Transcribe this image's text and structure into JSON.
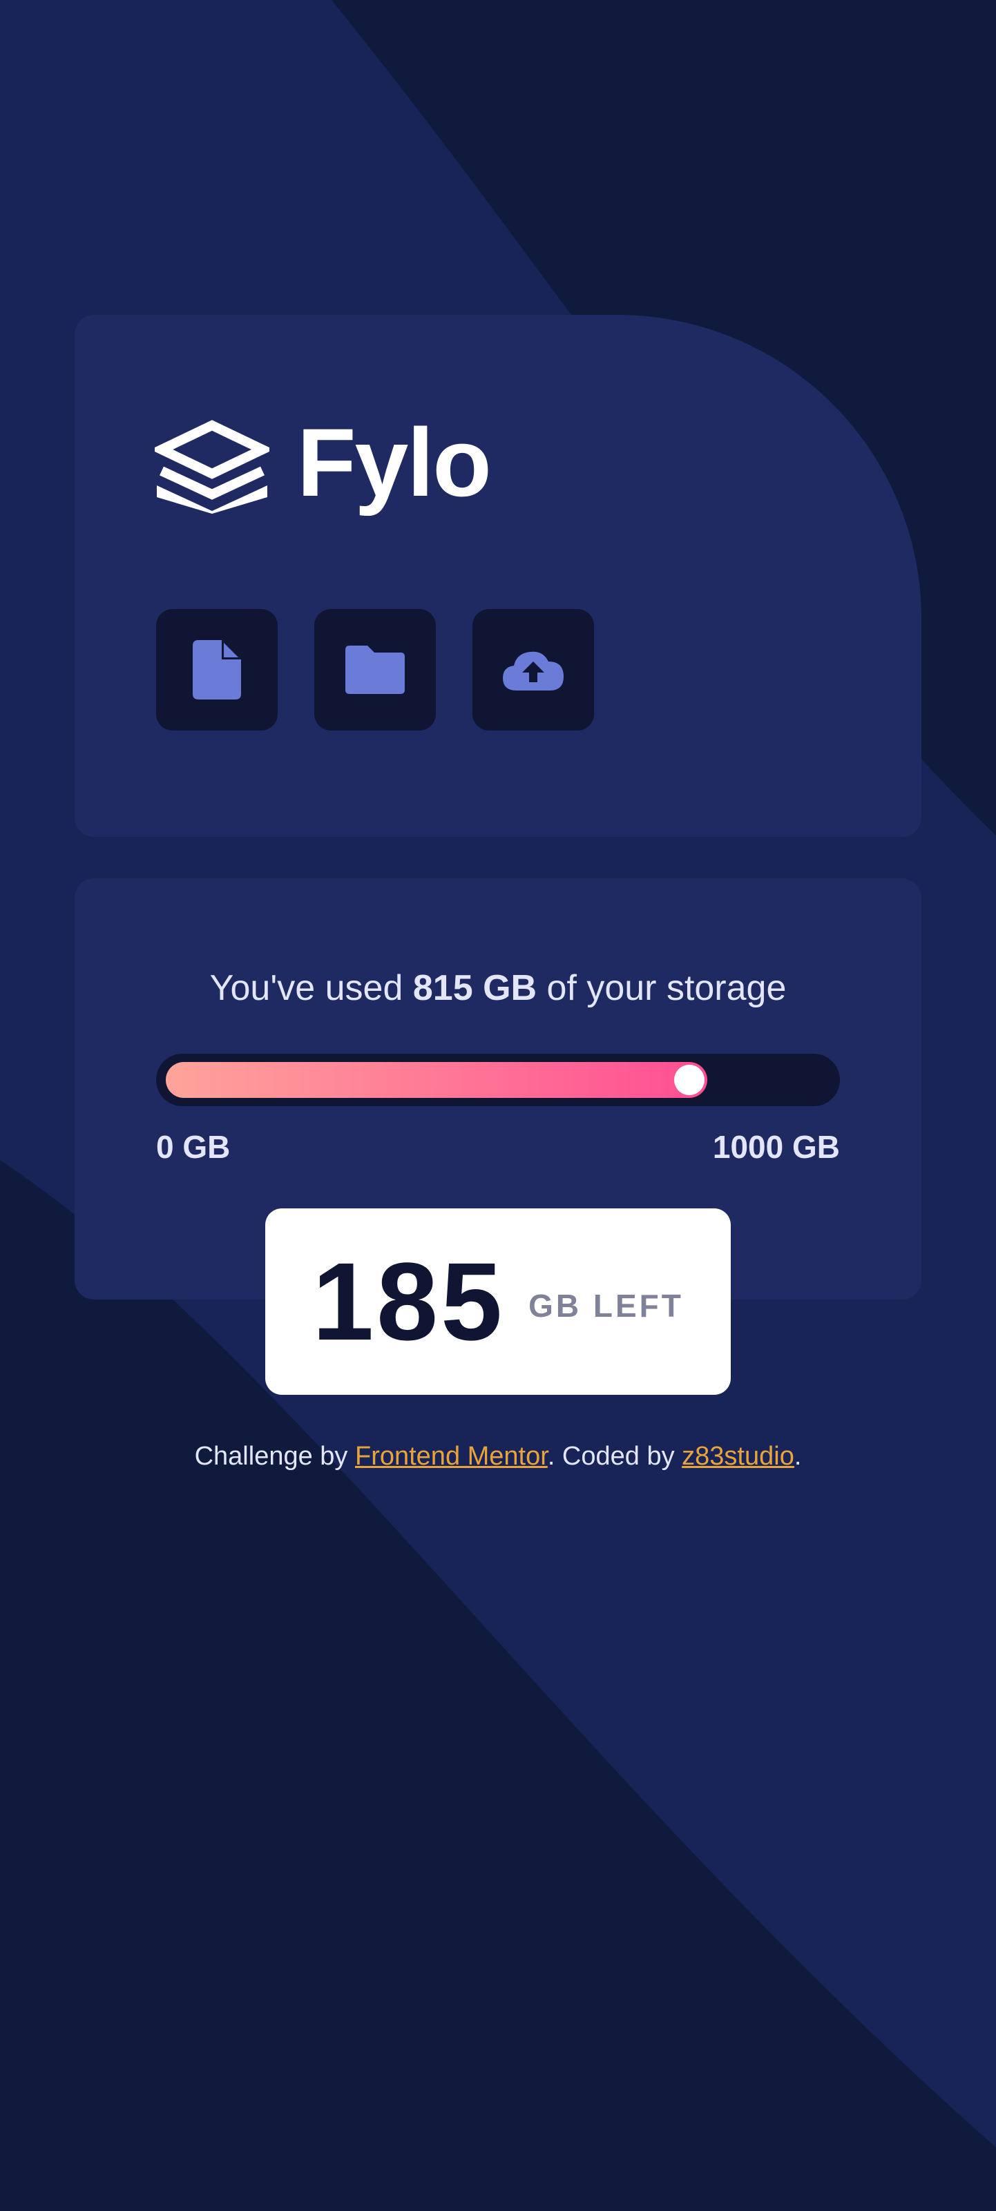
{
  "brand": {
    "name": "Fylo"
  },
  "toolbar": {
    "icons": [
      "document-icon",
      "folder-icon",
      "upload-icon"
    ]
  },
  "usage": {
    "prefix": "You've used ",
    "used_amount": "815 GB",
    "suffix": " of your storage",
    "min_label": "0 GB",
    "max_label": "1000 GB",
    "progress_fraction": 0.815
  },
  "remaining": {
    "number": "185",
    "unit_label": "GB LEFT"
  },
  "footer": {
    "prefix": "Challenge by ",
    "link1": "Frontend Mentor",
    "middle": ". Coded by ",
    "link2": "z83studio",
    "suffix": "."
  },
  "colors": {
    "background": "#101a3d",
    "card": "#1f2a63",
    "tile": "#0f1533",
    "gradient_start": "#ffa49a",
    "gradient_end": "#ff4e93",
    "link": "#e8a43a"
  }
}
